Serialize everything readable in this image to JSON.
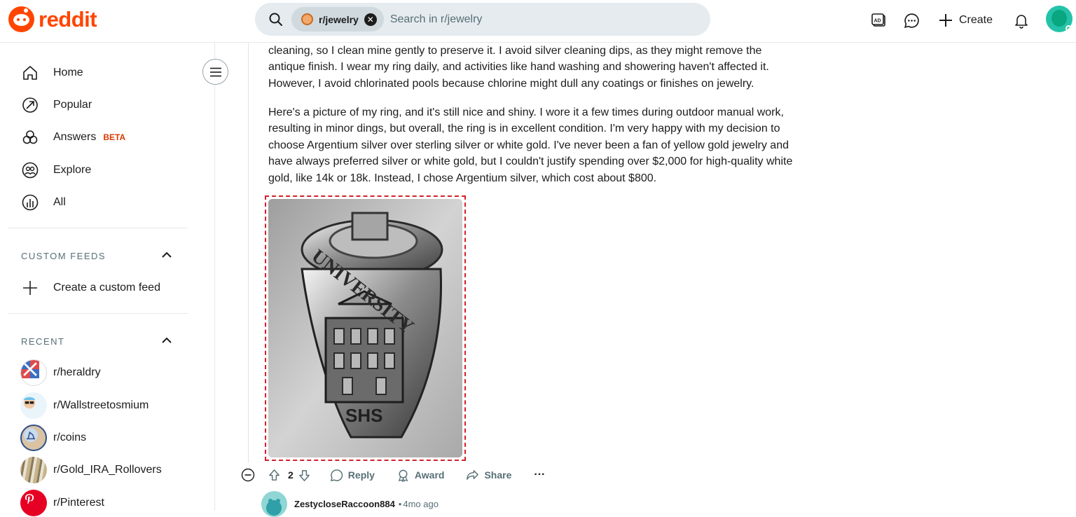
{
  "header": {
    "logo_text": "reddit",
    "search_chip": "r/jewelry",
    "search_placeholder": "Search in r/jewelry",
    "create_label": "Create"
  },
  "sidebar": {
    "nav": [
      {
        "label": "Home",
        "icon": "home-icon"
      },
      {
        "label": "Popular",
        "icon": "popular-icon"
      },
      {
        "label": "Answers",
        "icon": "answers-icon",
        "badge": "BETA"
      },
      {
        "label": "Explore",
        "icon": "explore-icon"
      },
      {
        "label": "All",
        "icon": "all-icon"
      }
    ],
    "custom_feeds_header": "CUSTOM FEEDS",
    "create_feed_label": "Create a custom feed",
    "recent_header": "RECENT",
    "recent": [
      {
        "label": "r/heraldry"
      },
      {
        "label": "r/Wallstreetosmium"
      },
      {
        "label": "r/coins"
      },
      {
        "label": "r/Gold_IRA_Rollovers"
      },
      {
        "label": "r/Pinterest"
      }
    ]
  },
  "comment": {
    "paragraph1": "cleaning, so I clean mine gently to preserve it. I avoid silver cleaning dips, as they might remove the antique finish. I wear my ring daily, and activities like hand washing and showering haven't affected it. However, I avoid chlorinated pools because chlorine might dull any coatings or finishes on jewelry.",
    "paragraph2": "Here's a picture of my ring, and it's still nice and shiny. I wore it a few times during outdoor manual work, resulting in minor dings, but overall, the ring is in excellent condition. I'm very happy with my decision to choose Argentium silver over sterling silver or white gold. I've never been a fan of yellow gold jewelry and have always preferred silver or white gold, but I couldn't justify spending over $2,000 for high-quality white gold, like 14k or 18k. Instead, I chose Argentium silver, which cost about $800.",
    "image_text_top": "UNIVERSITY",
    "image_text_bottom": "SHS",
    "vote_count": "2",
    "reply_label": "Reply",
    "award_label": "Award",
    "share_label": "Share",
    "more_label": "···"
  },
  "reply": {
    "author": "ZestycloseRaccoon884",
    "separator": "•",
    "time": "4mo ago"
  },
  "colors": {
    "brand": "#ff4500",
    "text": "#1c1c1c",
    "muted": "#576f76",
    "beta": "#d93a00"
  }
}
